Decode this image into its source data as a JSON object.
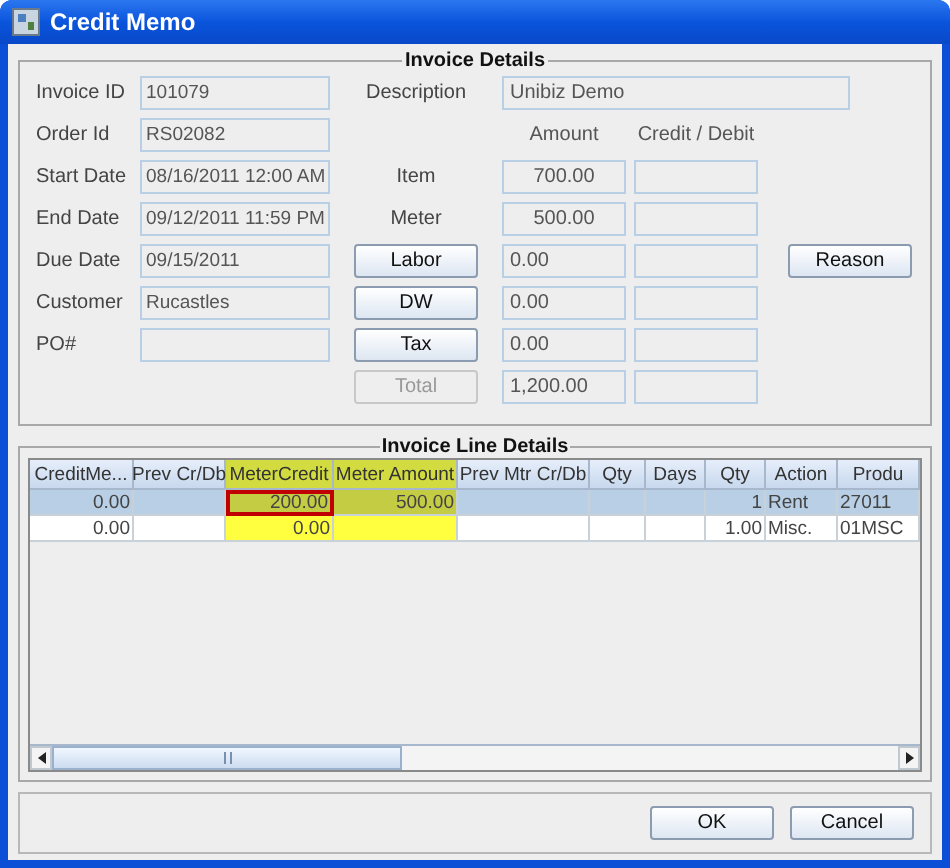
{
  "window": {
    "title": "Credit Memo"
  },
  "invoice_details": {
    "title": "Invoice Details",
    "fields": [
      {
        "label": "Invoice ID",
        "value": "101079"
      },
      {
        "label": "Order Id",
        "value": "RS02082"
      },
      {
        "label": "Start Date",
        "value": "08/16/2011 12:00 AM"
      },
      {
        "label": "End  Date",
        "value": "09/12/2011 11:59 PM"
      },
      {
        "label": "Due Date",
        "value": "09/15/2011"
      },
      {
        "label": "Customer",
        "value": "Rucastles"
      },
      {
        "label": "PO#"
      }
    ],
    "description": {
      "label": "Description",
      "value": "Unibiz Demo"
    },
    "amount_header": "Amount",
    "credit_debit_header": "Credit / Debit",
    "charges": [
      {
        "kind": "label",
        "label": "Item",
        "amount": "700.00"
      },
      {
        "kind": "label",
        "label": "Meter",
        "amount": "500.00"
      },
      {
        "kind": "button",
        "label": "Labor",
        "amount": "0.00",
        "disabled": false
      },
      {
        "kind": "button",
        "label": "DW",
        "amount": "0.00",
        "disabled": false
      },
      {
        "kind": "button",
        "label": "Tax",
        "amount": "0.00",
        "disabled": false
      },
      {
        "kind": "button",
        "label": "Total",
        "amount": "1,200.00",
        "disabled": true
      }
    ],
    "reason_button": "Reason"
  },
  "invoice_line_details": {
    "title": "Invoice Line Details",
    "columns": [
      {
        "label": "CreditMe...",
        "highlighted": false
      },
      {
        "label": "Prev Cr/Db",
        "highlighted": false
      },
      {
        "label": "MeterCredit",
        "highlighted": true
      },
      {
        "label": "Meter Amount",
        "highlighted": true
      },
      {
        "label": "Prev Mtr Cr/Db",
        "highlighted": false
      },
      {
        "label": "Qty",
        "highlighted": false
      },
      {
        "label": "Days",
        "highlighted": false
      },
      {
        "label": "Qty",
        "highlighted": false
      },
      {
        "label": "Action",
        "highlighted": false
      },
      {
        "label": "Produ",
        "highlighted": false
      }
    ],
    "rows": [
      {
        "selected": true,
        "cells": [
          {
            "text": "0.00",
            "focused": false
          },
          {
            "focused": false
          },
          {
            "text": "200.00",
            "focused": true
          },
          {
            "text": "500.00",
            "focused": false
          },
          {
            "focused": false
          },
          {
            "focused": false
          },
          {
            "focused": false
          },
          {
            "text": "1",
            "focused": false
          },
          {
            "text": "Rent",
            "focused": false
          },
          {
            "text": "27011",
            "focused": false
          }
        ]
      },
      {
        "selected": false,
        "cells": [
          {
            "text": "0.00",
            "focused": false
          },
          {
            "focused": false
          },
          {
            "text": "0.00",
            "focused": false
          },
          {
            "focused": false
          },
          {
            "focused": false
          },
          {
            "focused": false
          },
          {
            "focused": false
          },
          {
            "text": "1.00",
            "focused": false
          },
          {
            "text": "Misc.",
            "focused": false
          },
          {
            "text": "01MSC",
            "focused": false
          }
        ]
      }
    ]
  },
  "buttons": [
    {
      "label": "OK"
    },
    {
      "label": "Cancel"
    }
  ]
}
